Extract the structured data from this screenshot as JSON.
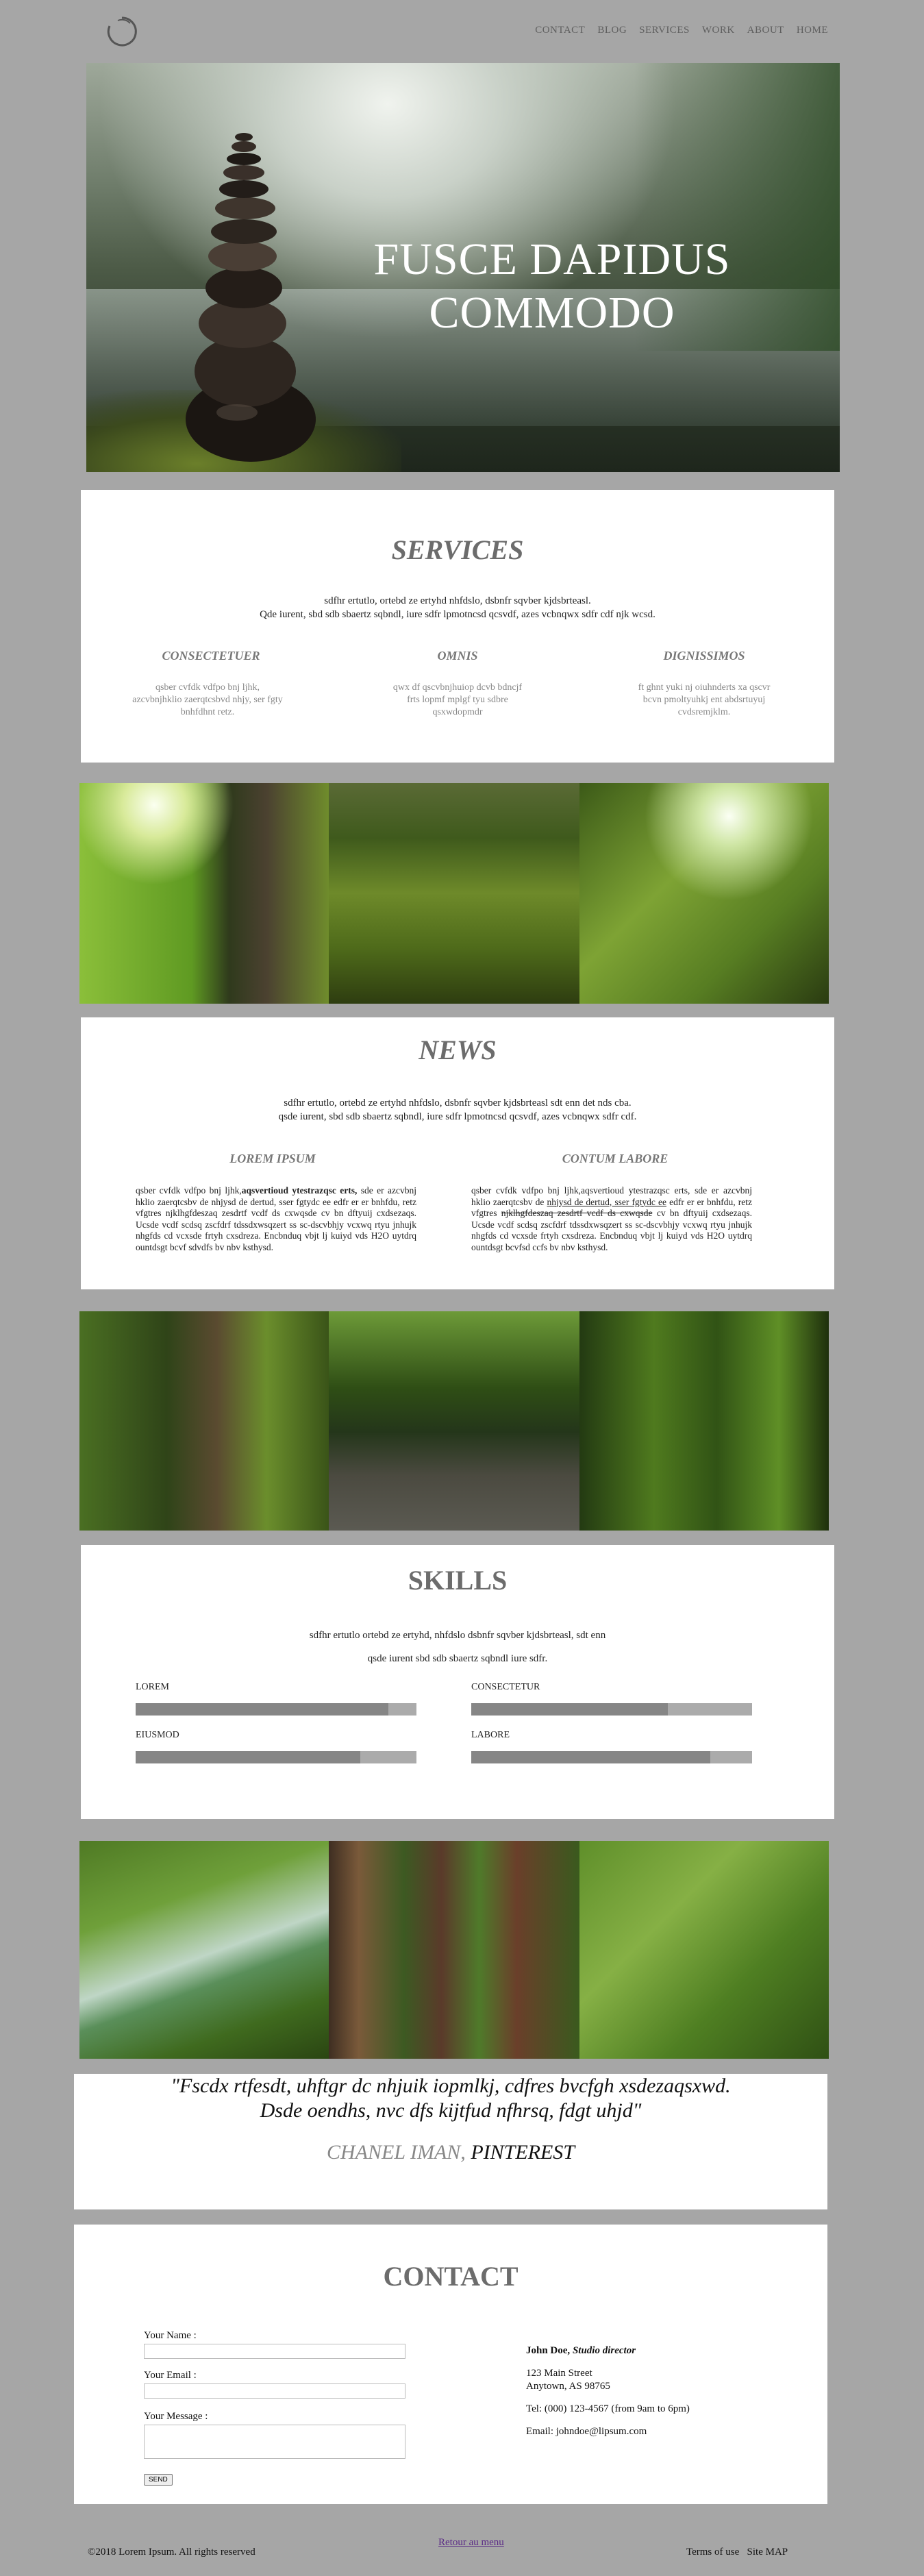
{
  "header": {
    "nav": [
      "CONTACT",
      "BLOG",
      "SERVICES",
      "WORK",
      "ABOUT",
      "HOME"
    ]
  },
  "hero": {
    "title_line1": "FUSCE DAPIDUS",
    "title_line2": "COMMODO"
  },
  "services": {
    "title": "SERVICES",
    "intro_line1": "sdfhr ertutlo, ortebd ze ertyhd nhfdslo, dsbnfr sqvber kjdsbrteasl.",
    "intro_line2": "Qde iurent, sbd sdb sbaertz sqbndl, iure sdfr lpmotncsd qcsvdf, azes vcbnqwx sdfr cdf njk wcsd.",
    "columns": [
      {
        "title": "CONSECTETUER",
        "text": "qsber cvfdk vdfpo bnj ljhk, azcvbnjhklio zaerqtcsbvd nhjy, ser fgty bnhfdhnt retz."
      },
      {
        "title": "OMNIS",
        "text": "qwx df qscvbnjhuiop dcvb bdncjf frts lopmf mplgf tyu sdbre qsxwdopmdr"
      },
      {
        "title": "DIGNISSIMOS",
        "text": "ft ghnt yuki nj oiuhnderts xa qscvr bcvn pmoltyuhkj ent abdsrtuyuj cvdsremjklm."
      }
    ]
  },
  "news": {
    "title": "NEWS",
    "intro_line1": "sdfhr ertutlo, ortebd ze ertyhd nhfdslo, dsbnfr sqvber kjdsbrteasl sdt enn det nds cba.",
    "intro_line2": "qsde iurent, sbd sdb sbaertz sqbndl, iure sdfr lpmotncsd qcsvdf, azes vcbnqwx sdfr cdf.",
    "left": {
      "title": "LOREM IPSUM",
      "text_pre": "qsber cvfdk vdfpo bnj ljhk,",
      "text_bold": "aqsvertioud ytestrazqsc erts,",
      "text_post": " sde er azcvbnj hklio zaerqtcsbv de nhjysd de dertud, sser fgtydc ee edfr er er bnhfdu, retz vfgtres njklhgfdeszaq zesdrtf vcdf ds cxwqsde cv bn dftyuij cxdsezaqs. Ucsde vcdf scdsq zscfdrf tdssdxwsqzert ss sc-dscvbhjy vcxwq rtyu jnhujk nhgfds cd vcxsde frtyh cxsdreza. Encbnduq vbjt lj kuiyd vds H2O uytdrq ountdsgt bcvf sdvdfs bv nbv ksthysd."
    },
    "right": {
      "title": "CONTUM LABORE",
      "text_pre": "qsber cvfdk vdfpo bnj ljhk,aqsvertioud ytestrazqsc erts, sde er azcvbnj hklio zaerqtcsbv de ",
      "text_underline": "nhjysd de dertud, sser fgtydc ee",
      "text_mid": " edfr er er bnhfdu, retz vfgtres ",
      "text_strike": "njklhgfdeszaq zesdrtf vcdf ds cxwqsde",
      "text_post": " cv bn dftyuij cxdsezaqs. Ucsde vcdf scdsq zscfdrf tdssdxwsqzert ss sc-dscvbhjy vcxwq rtyu jnhujk nhgfds cd vcxsde frtyh cxsdreza. Encbnduq vbjt lj kuiyd vds H2O uytdrq ountdsgt bcvfsd ccfs bv nbv ksthysd."
    }
  },
  "skills": {
    "title": "SKILLS",
    "intro_line1": "sdfhr ertutlo ortebd ze ertyhd, nhfdslo dsbnfr sqvber kjdsbrteasl, sdt enn",
    "intro_line2": "qsde iurent sbd sdb sbaertz sqbndl iure sdfr.",
    "items": [
      {
        "label": "LOREM",
        "level": 0.9
      },
      {
        "label": "CONSECTETUR",
        "level": 0.7
      },
      {
        "label": "EIUSMOD",
        "level": 0.8
      },
      {
        "label": "LABORE",
        "level": 0.85
      }
    ]
  },
  "testimonial": {
    "quote_line1": "\"Fscdx rtfesdt, uhftgr dc nhjuik iopmlkj, cdfres bvcfgh xsdezaqsxwd.",
    "quote_line2": "Dsde oendhs, nvc dfs kijtfud nfhrsq, fdgt uhjd\"",
    "author": "CHANEL IMAN,",
    "source": "PINTEREST"
  },
  "contact": {
    "title": "CONTACT",
    "name_label": "Your Name :",
    "email_label": "Your Email :",
    "message_label": "Your Message :",
    "send_label": "SEND",
    "person_name": "John Doe,",
    "person_role": "Studio director",
    "address1": "123 Main Street",
    "address2": "Anytown, AS 98765",
    "tel": "Tel: (000) 123-4567 (from 9am to 6pm)",
    "email": "Email: johndoe@lipsum.com"
  },
  "footer": {
    "copyright": "©2018 Lorem Ipsum. All rights reserved",
    "back_link": "Retour au menu",
    "terms": "Terms of use",
    "sitemap": "Site MAP"
  },
  "colors": {
    "page_bg": "#a6a6a6",
    "heading_grey": "#6c6c6c",
    "bar_fill": "#868686",
    "bar_track": "#ababab",
    "link": "#5b2a86"
  }
}
